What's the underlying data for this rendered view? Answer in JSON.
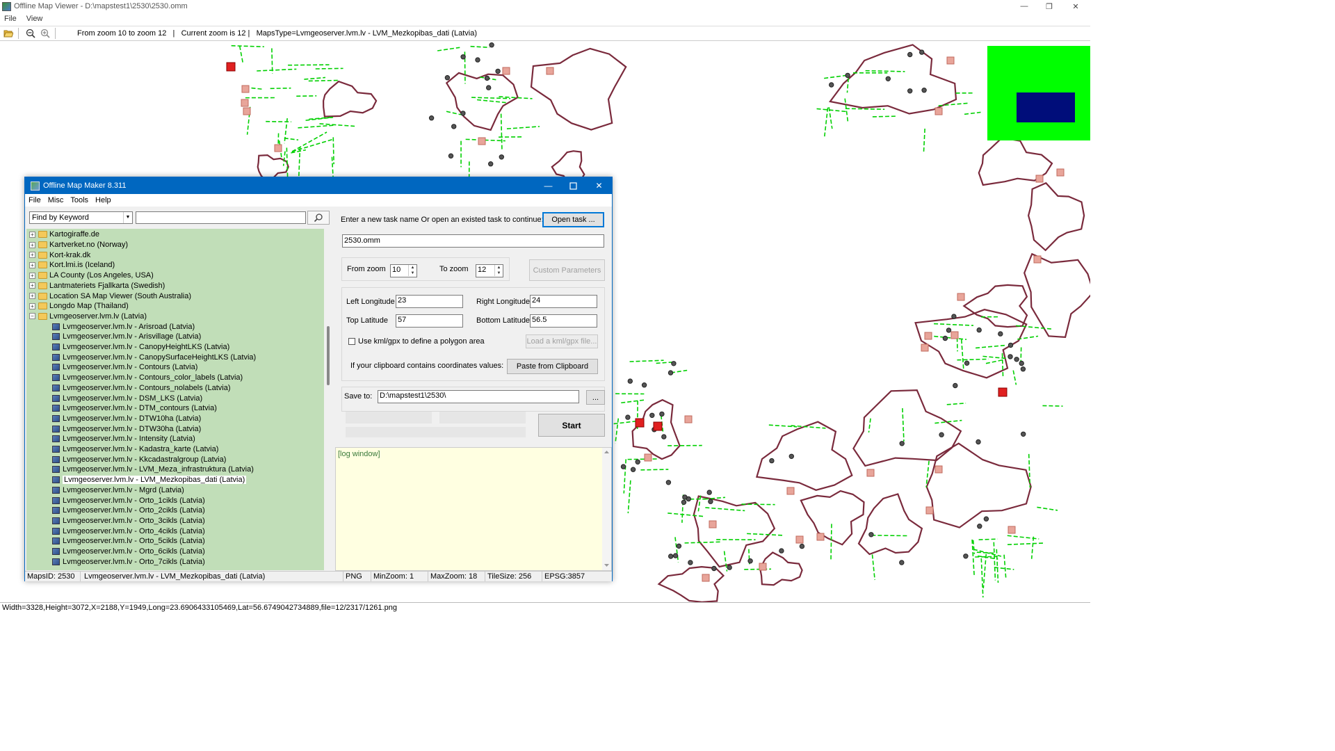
{
  "window": {
    "title": "Offline Map Viewer - D:\\mapstest1\\2530\\2530.omm",
    "menu": [
      "File",
      "View"
    ],
    "controls": {
      "minimize": "—",
      "restore": "❐",
      "close": "✕"
    }
  },
  "toolbar": {
    "info": "From zoom 10 to zoom 12   |   Current zoom is 12 |   MapsType=Lvmgeoserver.lvm.lv - LVM_Mezkopibas_dati (Latvia)"
  },
  "status": "Width=3328,Height=3072,X=2188,Y=1949,Long=23.6906433105469,Lat=56.6749042734889,file=12/2317/1261.png",
  "dialog": {
    "title": "Offline Map Maker 8.311",
    "menu": [
      "File",
      "Misc",
      "Tools",
      "Help"
    ],
    "search_mode": "Find by Keyword",
    "search_value": "",
    "tree": [
      {
        "label": "Kartogiraffe.de",
        "type": "folder",
        "expanded": false
      },
      {
        "label": "Kartverket.no (Norway)",
        "type": "folder",
        "expanded": false
      },
      {
        "label": "Kort-krak.dk",
        "type": "folder",
        "expanded": false
      },
      {
        "label": "Kort.lmi.is (Iceland)",
        "type": "folder",
        "expanded": false
      },
      {
        "label": "LA County (Los Angeles, USA)",
        "type": "folder",
        "expanded": false
      },
      {
        "label": "Lantmateriets Fjallkarta (Swedish)",
        "type": "folder",
        "expanded": false
      },
      {
        "label": "Location SA Map Viewer (South Australia)",
        "type": "folder",
        "expanded": false
      },
      {
        "label": "Longdo Map (Thailand)",
        "type": "folder",
        "expanded": false
      },
      {
        "label": "Lvmgeoserver.lvm.lv (Latvia)",
        "type": "folder",
        "expanded": true
      },
      {
        "label": "Lvmgeoserver.lvm.lv - Arisroad (Latvia)",
        "type": "map"
      },
      {
        "label": "Lvmgeoserver.lvm.lv - Arisvillage (Latvia)",
        "type": "map"
      },
      {
        "label": "Lvmgeoserver.lvm.lv - CanopyHeightLKS (Latvia)",
        "type": "map"
      },
      {
        "label": "Lvmgeoserver.lvm.lv - CanopySurfaceHeightLKS (Latvia)",
        "type": "map"
      },
      {
        "label": "Lvmgeoserver.lvm.lv - Contours (Latvia)",
        "type": "map"
      },
      {
        "label": "Lvmgeoserver.lvm.lv - Contours_color_labels (Latvia)",
        "type": "map"
      },
      {
        "label": "Lvmgeoserver.lvm.lv - Contours_nolabels (Latvia)",
        "type": "map"
      },
      {
        "label": "Lvmgeoserver.lvm.lv - DSM_LKS (Latvia)",
        "type": "map"
      },
      {
        "label": "Lvmgeoserver.lvm.lv - DTM_contours (Latvia)",
        "type": "map"
      },
      {
        "label": "Lvmgeoserver.lvm.lv - DTW10ha (Latvia)",
        "type": "map"
      },
      {
        "label": "Lvmgeoserver.lvm.lv - DTW30ha (Latvia)",
        "type": "map"
      },
      {
        "label": "Lvmgeoserver.lvm.lv - Intensity (Latvia)",
        "type": "map"
      },
      {
        "label": "Lvmgeoserver.lvm.lv - Kadastra_karte (Latvia)",
        "type": "map"
      },
      {
        "label": "Lvmgeoserver.lvm.lv - Kkcadastralgroup (Latvia)",
        "type": "map"
      },
      {
        "label": "Lvmgeoserver.lvm.lv - LVM_Meza_infrastruktura (Latvia)",
        "type": "map"
      },
      {
        "label": "Lvmgeoserver.lvm.lv - LVM_Mezkopibas_dati (Latvia)",
        "type": "map",
        "selected": true
      },
      {
        "label": "Lvmgeoserver.lvm.lv - Mgrd (Latvia)",
        "type": "map"
      },
      {
        "label": "Lvmgeoserver.lvm.lv - Orto_1cikls (Latvia)",
        "type": "map"
      },
      {
        "label": "Lvmgeoserver.lvm.lv - Orto_2cikls (Latvia)",
        "type": "map"
      },
      {
        "label": "Lvmgeoserver.lvm.lv - Orto_3cikls (Latvia)",
        "type": "map"
      },
      {
        "label": "Lvmgeoserver.lvm.lv - Orto_4cikls (Latvia)",
        "type": "map"
      },
      {
        "label": "Lvmgeoserver.lvm.lv - Orto_5cikls (Latvia)",
        "type": "map"
      },
      {
        "label": "Lvmgeoserver.lvm.lv - Orto_6cikls (Latvia)",
        "type": "map"
      },
      {
        "label": "Lvmgeoserver.lvm.lv - Orto_7cikls (Latvia)",
        "type": "map"
      }
    ],
    "task": {
      "prompt": "Enter a new task name Or open an existed task to continue:",
      "open_button": "Open task ...",
      "name": "2530.omm"
    },
    "zoom": {
      "from_label": "From zoom",
      "from_value": "10",
      "to_label": "To zoom",
      "to_value": "12",
      "custom_button": "Custom Parameters"
    },
    "coords": {
      "left_lon_label": "Left Longitude",
      "left_lon": "23",
      "right_lon_label": "Right Longitude",
      "right_lon": "24",
      "top_lat_label": "Top Latitude",
      "top_lat": "57",
      "bottom_lat_label": "Bottom Latitude",
      "bottom_lat": "56.5",
      "kml_label": "Use kml/gpx to define a polygon area",
      "kml_button": "Load a kml/gpx file...",
      "clipboard_label": "If your clipboard contains coordinates values:",
      "clipboard_button": "Paste from Clipboard"
    },
    "save": {
      "label": "Save to:",
      "path": "D:\\mapstest1\\2530\\",
      "browse": "..."
    },
    "start_button": "Start",
    "log_placeholder": "[log window]",
    "statusbar": {
      "maps_id": "MapsID: 2530",
      "maps_name": "Lvmgeoserver.lvm.lv - LVM_Mezkopibas_dati (Latvia)",
      "format": "PNG",
      "min_zoom": "MinZoom: 1",
      "max_zoom": "MaxZoom: 18",
      "tile_size": "TileSize: 256",
      "epsg": "EPSG:3857"
    }
  },
  "colors": {
    "dialog_title": "#0067c0",
    "tree_bg": "#c1deb8",
    "map_outline": "#7a2a3c",
    "map_green": "#00e000",
    "overview_green": "#00ff00",
    "overview_navy": "#000d7a",
    "log_bg": "#ffffe1"
  }
}
